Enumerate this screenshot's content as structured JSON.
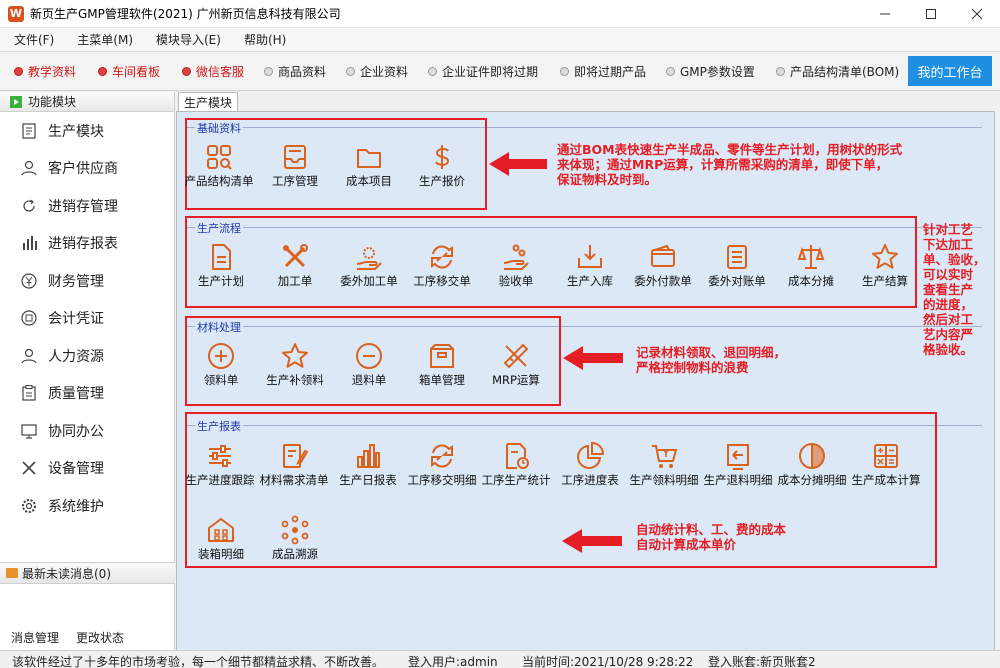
{
  "window": {
    "title": "新页生产GMP管理软件(2021) 广州新页信息科技有限公司",
    "icon": "W"
  },
  "menu": [
    "文件(F)",
    "主菜单(M)",
    "模块导入(E)",
    "帮助(H)"
  ],
  "toolbar": {
    "items": [
      "教学资料",
      "车间看板",
      "微信客服",
      "商品资料",
      "企业资料",
      "企业证件即将过期",
      "即将过期产品",
      "GMP参数设置",
      "产品结构清单(BOM)"
    ],
    "workbench": "我的工作台"
  },
  "sidebar": {
    "header": "功能模块",
    "items": [
      "生产模块",
      "客户供应商",
      "进销存管理",
      "进销存报表",
      "财务管理",
      "会计凭证",
      "人力资源",
      "质量管理",
      "协同办公",
      "设备管理",
      "系统维护"
    ],
    "messages": "最新未读消息(0)",
    "footer": [
      "消息管理",
      "更改状态"
    ]
  },
  "tab": "生产模块",
  "sections": {
    "basic": {
      "title": "基础资料",
      "items": [
        "产品结构清单",
        "工序管理",
        "成本项目",
        "生产报价"
      ]
    },
    "flow": {
      "title": "生产流程",
      "items": [
        "生产计划",
        "加工单",
        "委外加工单",
        "工序移交单",
        "验收单",
        "生产入库",
        "委外付款单",
        "委外对账单",
        "成本分摊",
        "生产结算"
      ]
    },
    "material": {
      "title": "材料处理",
      "items": [
        "领料单",
        "生产补领料",
        "退料单",
        "箱单管理",
        "MRP运算"
      ]
    },
    "report": {
      "title": "生产报表",
      "items": [
        "生产进度跟踪",
        "材料需求清单",
        "生产日报表",
        "工序移交明细",
        "工序生产统计",
        "工序进度表",
        "生产领料明细",
        "生产退料明细",
        "成本分摊明细",
        "生产成本计算",
        "装箱明细",
        "成品溯源"
      ]
    }
  },
  "notes": {
    "basic": [
      "通过BOM表快速生产半成品、零件等生产计划，用树状的形式",
      "来体现；通过MRP运算，计算所需采购的清单，即使下单，",
      "保证物料及时到。"
    ],
    "flow": [
      "针对工艺",
      "下达加工",
      "单、验收，",
      "可以实时",
      "查看生产",
      "的进度，",
      "然后对工",
      "艺内容严",
      "格验收。"
    ],
    "material": [
      "记录材料领取、退回明细，",
      "严格控制物料的浪费"
    ],
    "report": [
      "自动统计料、工、费的成本",
      "自动计算成本单价"
    ]
  },
  "status": {
    "slogan": "该软件经过了十多年的市场考验，每一个细节都精益求精、不断改善。",
    "user": "登入用户:admin",
    "time": "当前时间:2021/10/28 9:28:22",
    "account": "登入账套:新页账套2"
  },
  "colors": {
    "accent": "#1e8fe1",
    "icon": "#d9621f",
    "annotation": "#e31e24",
    "section_title": "#1f3aa6",
    "panel": "#dde8f6"
  }
}
